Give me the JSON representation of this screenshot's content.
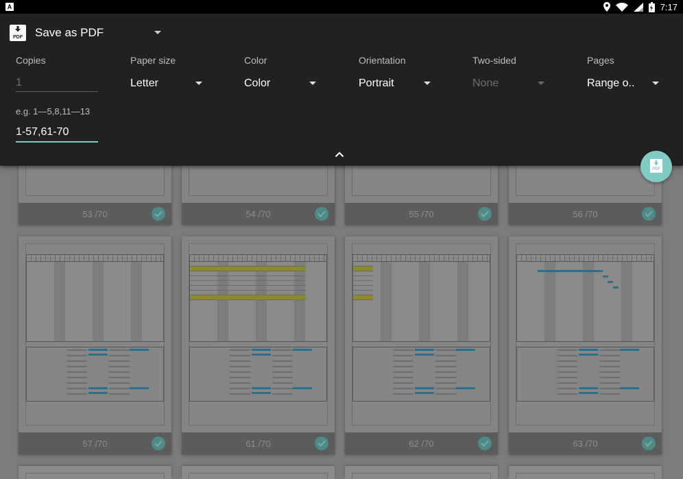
{
  "status_bar": {
    "app_icon": "A",
    "time": "7:17",
    "icons": [
      "location-icon",
      "wifi-icon",
      "signal-icon",
      "battery-icon"
    ]
  },
  "print_settings": {
    "title": "Save as PDF",
    "copies": {
      "label": "Copies",
      "value": "1"
    },
    "paper_size": {
      "label": "Paper size",
      "value": "Letter"
    },
    "color": {
      "label": "Color",
      "value": "Color"
    },
    "orientation": {
      "label": "Orientation",
      "value": "Portrait"
    },
    "two_sided": {
      "label": "Two-sided",
      "value": "None"
    },
    "pages": {
      "label": "Pages",
      "value": "Range o..",
      "hint": "e.g. 1—5,8,11—13",
      "range": "1-57,61-70"
    }
  },
  "colors": {
    "panel": "#212121",
    "accent": "#80cbc4",
    "backdrop": "#7b7b7b"
  },
  "pages_row1": [
    {
      "label": "53 /70",
      "selected": true
    },
    {
      "label": "54 /70",
      "selected": true
    },
    {
      "label": "55 /70",
      "selected": true
    },
    {
      "label": "56 /70",
      "selected": true
    }
  ],
  "pages_row2": [
    {
      "label": "57 /70",
      "selected": true
    },
    {
      "label": "61 /70",
      "selected": true
    },
    {
      "label": "62 /70",
      "selected": true
    },
    {
      "label": "63 /70",
      "selected": true
    }
  ]
}
